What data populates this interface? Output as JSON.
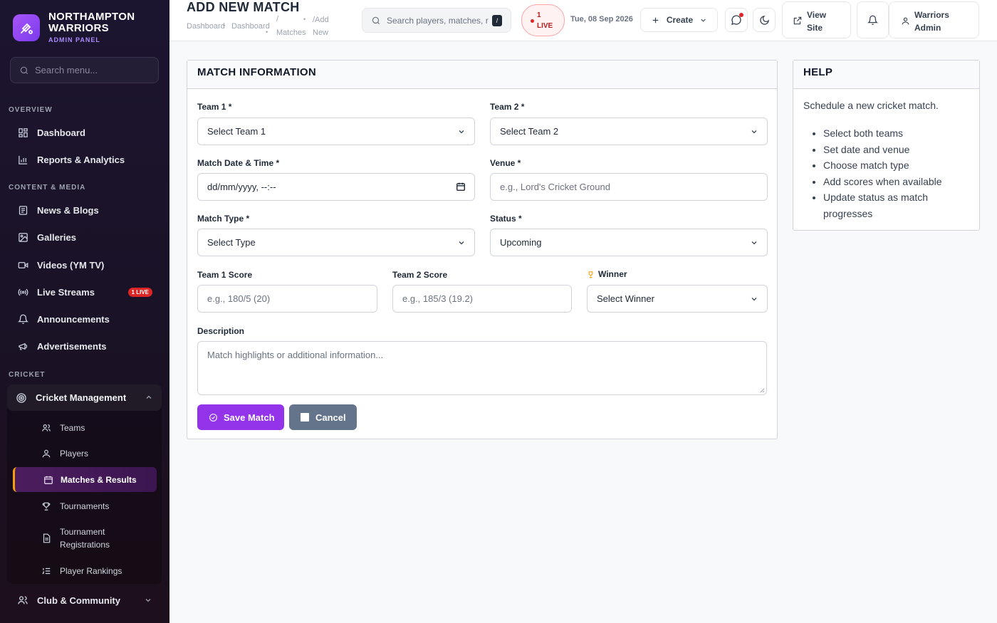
{
  "brand": {
    "name_line1": "NORTHAMPTON",
    "name_line2": "WARRIORS",
    "sub": "ADMIN PANEL"
  },
  "sidebar": {
    "search_placeholder": "Search menu...",
    "sections": {
      "overview": "OVERVIEW",
      "content": "CONTENT & MEDIA",
      "cricket": "CRICKET"
    },
    "items": {
      "dashboard": "Dashboard",
      "reports": "Reports & Analytics",
      "news": "News & Blogs",
      "galleries": "Galleries",
      "videos": "Videos (YM TV)",
      "live_streams": "Live Streams",
      "live_badge": "1 LIVE",
      "announcements": "Announcements",
      "advertisements": "Advertisements",
      "cricket_mgmt": "Cricket Management",
      "teams": "Teams",
      "players": "Players",
      "matches": "Matches & Results",
      "tournaments": "Tournaments",
      "tournament_reg_1": "Tournament",
      "tournament_reg_2": "Registrations",
      "rankings": "Player Rankings",
      "club": "Club & Community"
    }
  },
  "topbar": {
    "title": "ADD NEW MATCH",
    "breadcrumb": {
      "a": "Dashboard",
      "b": "Dashboard",
      "slash": "/",
      "c1": "/Add",
      "c2": "Matches",
      "c3": "New"
    },
    "search_placeholder": "Search players, matches, r",
    "search_kbd": "/",
    "live_count": "1",
    "live_label": "LIVE",
    "date": "Tue, 08 Sep 2026",
    "create_label": "Create",
    "view_site_1": "View",
    "view_site_2": "Site",
    "user_1": "Warriors",
    "user_2": "Admin"
  },
  "form": {
    "card_title": "MATCH INFORMATION",
    "team1_label": "Team 1 *",
    "team1_value": "Select Team 1",
    "team2_label": "Team 2 *",
    "team2_value": "Select Team 2",
    "date_label": "Match Date & Time *",
    "date_placeholder": "dd/mm/yyyy, --:--",
    "venue_label": "Venue *",
    "venue_placeholder": "e.g., Lord's Cricket Ground",
    "type_label": "Match Type *",
    "type_value": "Select Type",
    "status_label": "Status *",
    "status_value": "Upcoming",
    "score1_label": "Team 1 Score",
    "score1_placeholder": "e.g., 180/5 (20)",
    "score2_label": "Team 2 Score",
    "score2_placeholder": "e.g., 185/3 (19.2)",
    "winner_label": "Winner",
    "winner_value": "Select Winner",
    "desc_label": "Description",
    "desc_placeholder": "Match highlights or additional information...",
    "save_label": "Save Match",
    "cancel_label": "Cancel"
  },
  "help": {
    "title": "HELP",
    "intro": "Schedule a new cricket match.",
    "items": [
      "Select both teams",
      "Set date and venue",
      "Choose match type",
      "Add scores when available",
      "Update status as match",
      "progresses"
    ]
  },
  "colors": {
    "accent": "#9333ea",
    "live": "#dc2626",
    "active_marker": "#f59e0b"
  }
}
